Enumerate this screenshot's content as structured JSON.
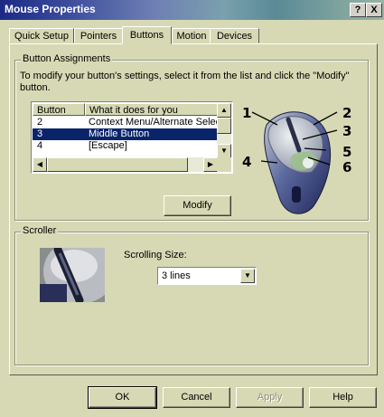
{
  "window": {
    "title": "Mouse Properties",
    "help_glyph": "?",
    "close_glyph": "X"
  },
  "tabs": [
    {
      "label": "Quick Setup"
    },
    {
      "label": "Pointers"
    },
    {
      "label": "Buttons"
    },
    {
      "label": "Motion"
    },
    {
      "label": "Devices"
    }
  ],
  "active_tab": "Buttons",
  "button_assignments": {
    "group_label": "Button Assignments",
    "instructions": "To modify your button's settings, select it from the list and click the \"Modify\" button.",
    "columns": [
      "Button",
      "What it does for you"
    ],
    "rows": [
      {
        "button": "2",
        "action": "Context Menu/Alternate Select"
      },
      {
        "button": "3",
        "action": "Middle Button"
      },
      {
        "button": "4",
        "action": "[Escape]"
      }
    ],
    "selected_row": 1,
    "modify_label": "Modify",
    "callouts": [
      "1",
      "2",
      "3",
      "4",
      "5",
      "6"
    ]
  },
  "scroller": {
    "group_label": "Scroller",
    "scrolling_size_label": "Scrolling Size:",
    "scrolling_size_value": "3 lines"
  },
  "footer": {
    "ok": "OK",
    "cancel": "Cancel",
    "apply": "Apply",
    "help": "Help"
  },
  "colors": {
    "selection": "#0a246a",
    "dialog_face": "#d6d9b4"
  }
}
